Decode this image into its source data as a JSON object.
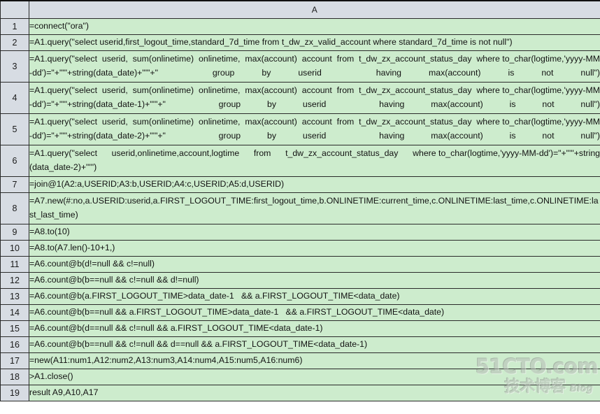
{
  "sheet": {
    "column_header": "A",
    "corner_label": "",
    "colors": {
      "cell_background": "#cdeccd",
      "header_background": "#d7dce3",
      "grid_line": "#2a2a2a",
      "text": "#121212"
    },
    "rows": [
      {
        "num": "1",
        "text": "=connect(\"ora\")",
        "lines": 1,
        "justify": false
      },
      {
        "num": "2",
        "text": "=A1.query(\"select userid,first_logout_time,standard_7d_time from t_dw_zx_valid_account where standard_7d_time is not null\")",
        "lines": 1,
        "justify": true
      },
      {
        "num": "3",
        "text": "=A1.query(\"select  userid,  sum(onlinetime)  onlinetime,  max(account)  account  from  t_dw_zx_account_status_day  where to_char(logtime,'yyyy-MM-dd')=\"+\"'\"+string(data_date)+\"'\"+\"  group by userid  having max(account) is not null\")",
        "lines": 2,
        "justify": true
      },
      {
        "num": "4",
        "text": "=A1.query(\"select  userid,  sum(onlinetime)  onlinetime,  max(account)  account  from  t_dw_zx_account_status_day  where to_char(logtime,'yyyy-MM-dd')=\"+\"'\"+string(data_date-1)+\"'\"+\"  group by userid  having max(account) is not null\")",
        "lines": 2,
        "justify": true
      },
      {
        "num": "5",
        "text": "=A1.query(\"select  userid,  sum(onlinetime)  onlinetime,  max(account)  account  from  t_dw_zx_account_status_day  where to_char(logtime,'yyyy-MM-dd')=\"+\"'\"+string(data_date-2)+\"'\"+\"  group by userid  having max(account) is not null\")",
        "lines": 2,
        "justify": true
      },
      {
        "num": "6",
        "text": "=A1.query(\"select      userid,onlinetime,account,logtime      from      t_dw_zx_account_status_day      where to_char(logtime,'yyyy-MM-dd')=\"+\"'\"+string(data_date-2)+\"'\")",
        "lines": 2,
        "justify": true
      },
      {
        "num": "7",
        "text": "=join@1(A2:a,USERID;A3:b,USERID;A4:c,USERID;A5:d,USERID)",
        "lines": 1,
        "justify": false
      },
      {
        "num": "8",
        "text": "=A7.new(#:no,a.USERID:userid,a.FIRST_LOGOUT_TIME:first_logout_time,b.ONLINETIME:current_time,c.ONLINETIME:last_time,c.ONLINETIME:last_last_time)",
        "lines": 2,
        "justify": false
      },
      {
        "num": "9",
        "text": "=A8.to(10)",
        "lines": 1,
        "justify": false
      },
      {
        "num": "10",
        "text": "=A8.to(A7.len()-10+1,)",
        "lines": 1,
        "justify": false
      },
      {
        "num": "11",
        "text": "=A6.count@b(d!=null && c!=null)",
        "lines": 1,
        "justify": false
      },
      {
        "num": "12",
        "text": "=A6.count@b(b==null && c!=null && d!=null)",
        "lines": 1,
        "justify": false
      },
      {
        "num": "13",
        "text": "=A6.count@b(a.FIRST_LOGOUT_TIME>data_date-1   && a.FIRST_LOGOUT_TIME<data_date)",
        "lines": 1,
        "justify": false
      },
      {
        "num": "14",
        "text": "=A6.count@b(b==null && a.FIRST_LOGOUT_TIME>data_date-1   && a.FIRST_LOGOUT_TIME<data_date)",
        "lines": 1,
        "justify": false
      },
      {
        "num": "15",
        "text": "=A6.count@b(d==null && c!=null && a.FIRST_LOGOUT_TIME<data_date-1)",
        "lines": 1,
        "justify": false
      },
      {
        "num": "16",
        "text": "=A6.count@b(b==null && c!=null && d==null && a.FIRST_LOGOUT_TIME<data_date-1)",
        "lines": 1,
        "justify": false
      },
      {
        "num": "17",
        "text": "=new(A11:num1,A12:num2,A13:num3,A14:num4,A15:num5,A16:num6)",
        "lines": 1,
        "justify": false
      },
      {
        "num": "18",
        "text": ">A1.close()",
        "lines": 1,
        "justify": false
      },
      {
        "num": "19",
        "text": "result A9,A10,A17",
        "lines": 1,
        "justify": false
      }
    ]
  },
  "watermark": {
    "main": "51CTO.com",
    "chinese": "技术博客",
    "blog": "Blog"
  }
}
